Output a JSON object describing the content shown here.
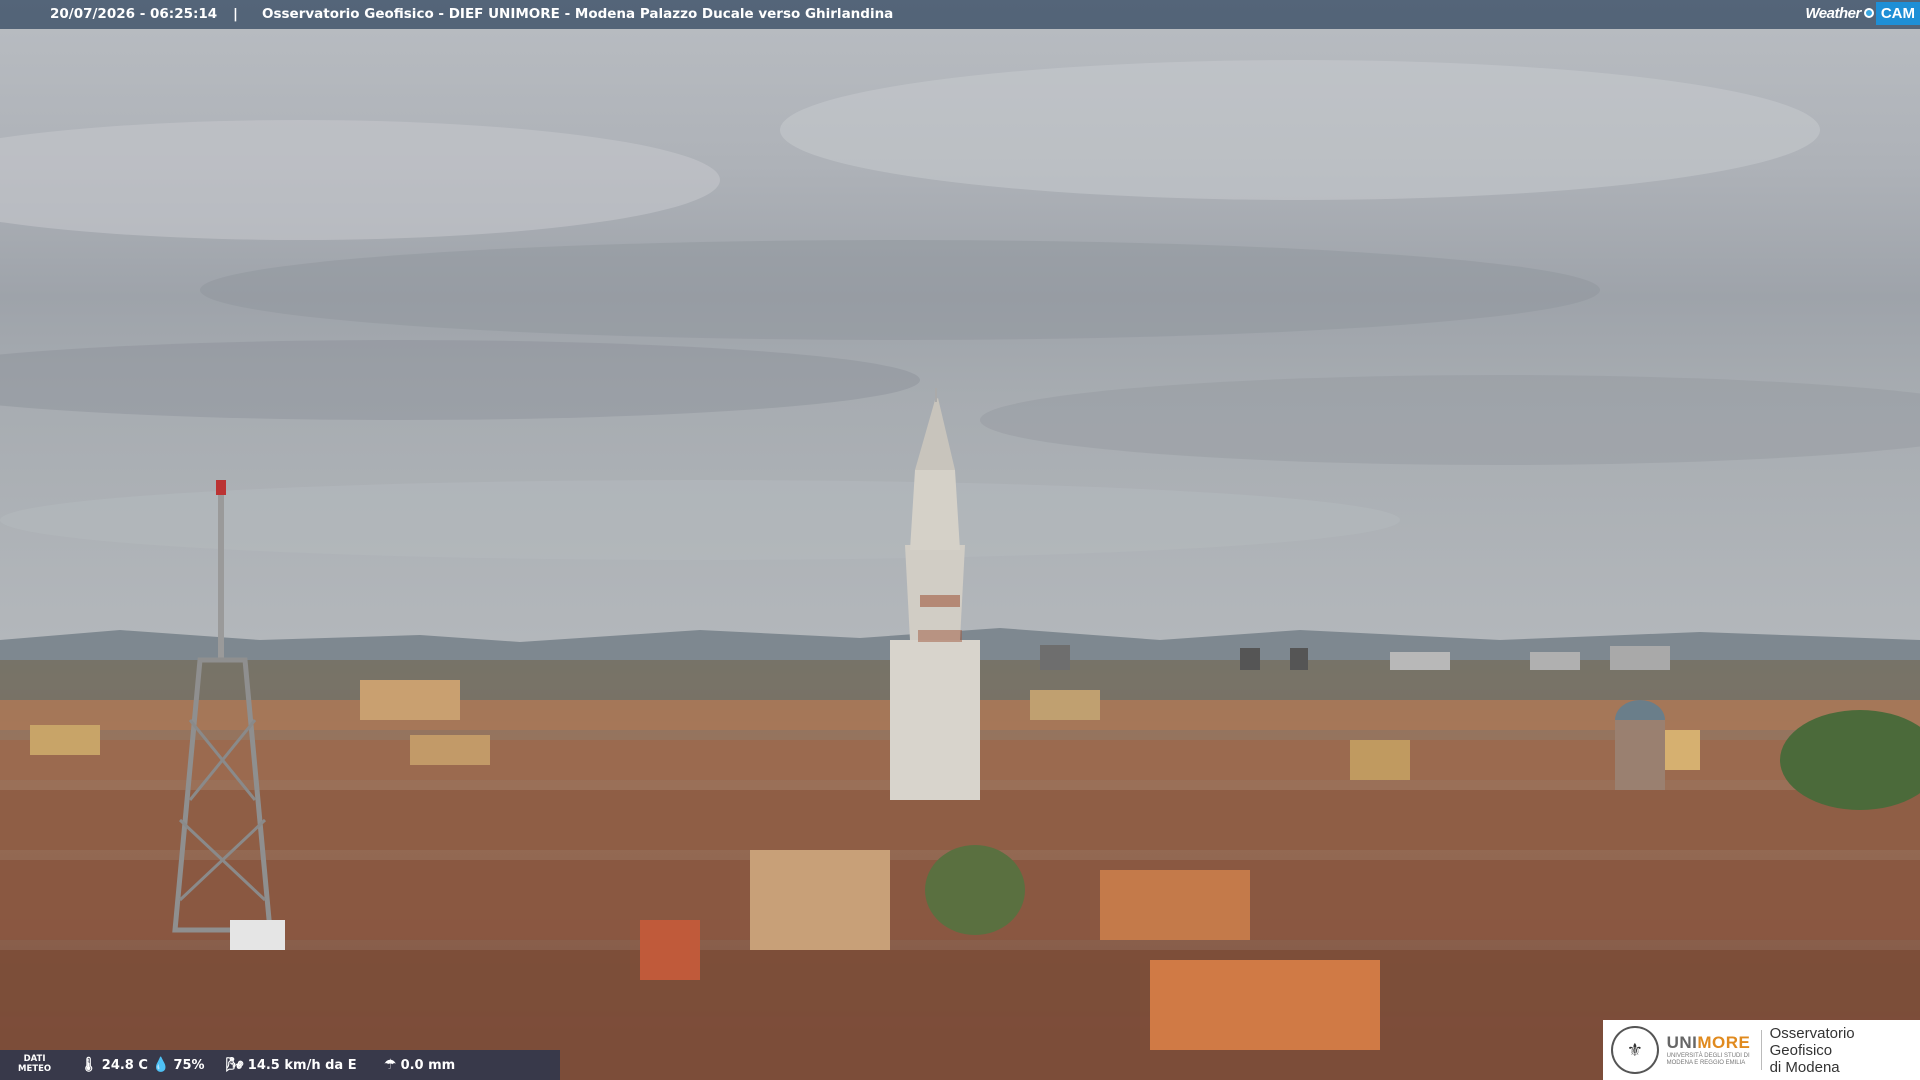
{
  "overlay": {
    "timestamp": "20/07/2026 - 06:25:14",
    "separator": "|",
    "caption": "Osservatorio Geofisico - DIEF UNIMORE - Modena Palazzo Ducale verso Ghirlandina"
  },
  "logo": {
    "weather": "Weather",
    "cam": "CAM"
  },
  "weather_data": {
    "label_line1": "DATI",
    "label_line2": "METEO",
    "temperature": "24.8 C",
    "humidity": "75%",
    "wind": "14.5 km/h da E",
    "rain": "0.0 mm"
  },
  "institution": {
    "brand_a": "UNI",
    "brand_b": "MORE",
    "brand_sub": "UNIVERSITÀ DEGLI STUDI DI MODENA E REGGIO EMILIA",
    "line1": "Osservatorio Geofisico",
    "line2": "di Modena"
  },
  "icons": {
    "temperature": "thermometer-icon",
    "humidity": "droplet-icon",
    "wind": "wind-sock-icon",
    "rain": "rain-gauge-icon"
  }
}
